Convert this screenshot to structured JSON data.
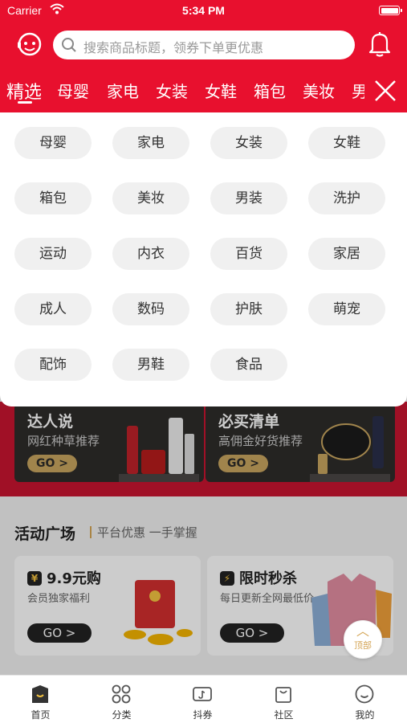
{
  "status_bar": {
    "carrier": "Carrier",
    "time": "5:34 PM"
  },
  "header": {
    "search_placeholder": "搜索商品标题，领券下单更优惠"
  },
  "category_tabs": [
    "精选",
    "母婴",
    "家电",
    "女装",
    "女鞋",
    "箱包",
    "美妆",
    "男"
  ],
  "dropdown_categories": [
    "母婴",
    "家电",
    "女装",
    "女鞋",
    "箱包",
    "美妆",
    "男装",
    "洗护",
    "运动",
    "内衣",
    "百货",
    "家居",
    "成人",
    "数码",
    "护肤",
    "萌宠",
    "配饰",
    "男鞋",
    "食品"
  ],
  "promo_cards": [
    {
      "title": "达人说",
      "subtitle": "网红种草推荐",
      "button": "GO >"
    },
    {
      "title": "必买清单",
      "subtitle": "高佣金好货推荐",
      "button": "GO >"
    }
  ],
  "activity": {
    "title": "活动广场",
    "subtitle": "平台优惠 一手掌握",
    "cards": [
      {
        "title": "9.9元购",
        "subtitle": "会员独家福利",
        "button": "GO >"
      },
      {
        "title": "限时秒杀",
        "subtitle": "每日更新全网最低价",
        "button": "GO >"
      }
    ]
  },
  "back_to_top": {
    "arrow": "︿",
    "label": "顶部"
  },
  "tabbar": [
    "首页",
    "分类",
    "抖券",
    "社区",
    "我的"
  ],
  "colors": {
    "brand_red": "#e8102e",
    "gold": "#c9a560"
  }
}
